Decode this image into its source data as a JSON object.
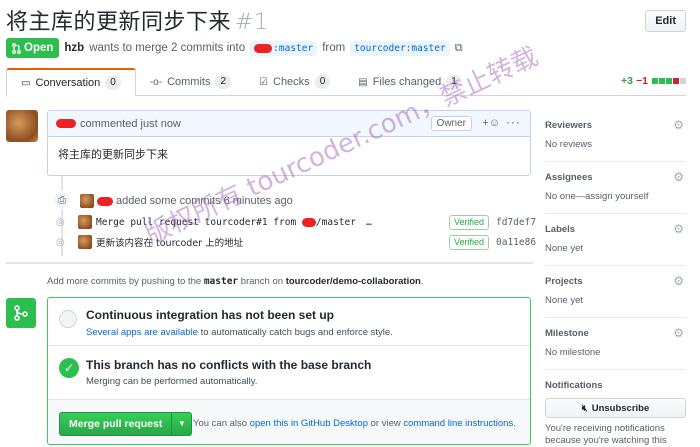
{
  "header": {
    "title": "将主库的更新同步下来",
    "number": "#1",
    "edit_label": "Edit"
  },
  "meta": {
    "state": "Open",
    "author": "hzb",
    "text_middle": "wants to merge 2 commits into",
    "base_branch": ":master",
    "from_label": "from",
    "head_branch": "tourcoder:master"
  },
  "tabs": [
    {
      "label": "Conversation",
      "count": "0",
      "icon": "comment-icon"
    },
    {
      "label": "Commits",
      "count": "2",
      "icon": "commit-icon"
    },
    {
      "label": "Checks",
      "count": "0",
      "icon": "checklist-icon"
    },
    {
      "label": "Files changed",
      "count": "1",
      "icon": "file-diff-icon"
    }
  ],
  "diffstat": {
    "additions": "+3",
    "deletions": "−1"
  },
  "comment": {
    "action": "commented just now",
    "badge": "Owner",
    "body": "将主库的更新同步下来"
  },
  "event": {
    "text": "added some commits 6 minutes ago"
  },
  "commits": [
    {
      "message_prefix": "Merge pull request tourcoder#1 from ",
      "message_suffix": "/master",
      "more": "…",
      "verified": "Verified",
      "sha": "fd7def7"
    },
    {
      "message_prefix": "更新该内容在 tourcoder 上的地址",
      "message_suffix": "",
      "more": "",
      "verified": "Verified",
      "sha": "0a11e86"
    }
  ],
  "push_hint": {
    "prefix": "Add more commits by pushing to the ",
    "branch": "master",
    "middle": " branch on ",
    "repo": "tourcoder/demo-collaboration",
    "suffix": "."
  },
  "merge_box": {
    "ci_title": "Continuous integration has not been set up",
    "ci_link": "Several apps are available",
    "ci_rest": " to automatically catch bugs and enforce style.",
    "ok_title": "This branch has no conflicts with the base branch",
    "ok_sub": "Merging can be performed automatically.",
    "merge_button": "Merge pull request",
    "foot_prefix": "You can also ",
    "foot_link1": "open this in GitHub Desktop",
    "foot_middle": " or view ",
    "foot_link2": "command line instructions",
    "foot_suffix": "."
  },
  "sidebar": {
    "sections": [
      {
        "title": "Reviewers",
        "value": "No reviews"
      },
      {
        "title": "Assignees",
        "value": "No one—assign yourself"
      },
      {
        "title": "Labels",
        "value": "None yet"
      },
      {
        "title": "Projects",
        "value": "None yet"
      },
      {
        "title": "Milestone",
        "value": "No milestone"
      }
    ],
    "notifications_title": "Notifications",
    "unsubscribe": "Unsubscribe",
    "notif_text": "You're receiving notifications because you're watching this"
  },
  "watermark": {
    "main": "版权所有 tourcoder.com，禁止转载"
  },
  "colors": {
    "open_green": "#2cbe4e",
    "accent_orange": "#e36209",
    "link_blue": "#0366d6",
    "redaction_red": "#e22"
  }
}
